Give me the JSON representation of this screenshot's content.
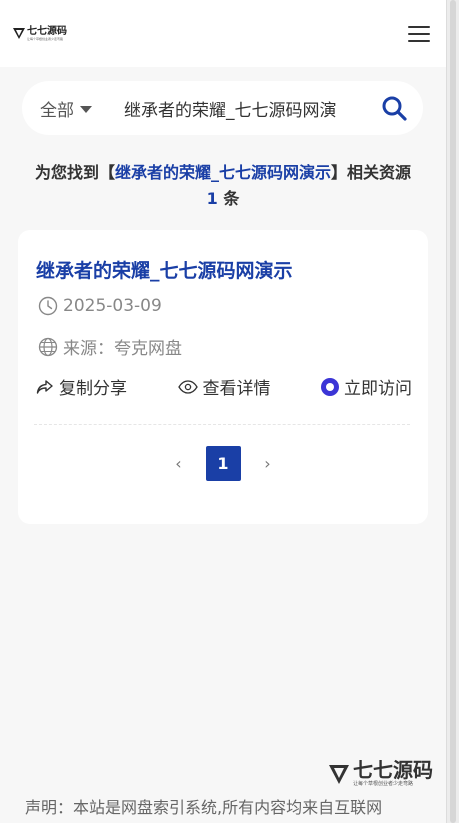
{
  "header": {
    "logo_text": "七七源码",
    "logo_subtext": "让每个草根创业者少走弯路",
    "menu_icon": "hamburger-menu-icon"
  },
  "search": {
    "category": "全部",
    "query": "继承者的荣耀_七七源码网演",
    "search_icon": "search-icon"
  },
  "summary": {
    "prefix": "为您找到【",
    "keyword": "继承者的荣耀_七七源码网演示",
    "middle": "】相关资源",
    "count": "1",
    "suffix": "条"
  },
  "result": {
    "title": "继承者的荣耀_七七源码网演示",
    "date": "2025-03-09",
    "source": "来源：夸克网盘",
    "actions": {
      "copy_share": "复制分享",
      "view_detail": "查看详情",
      "visit": "立即访问"
    }
  },
  "pagination": {
    "prev": "‹",
    "current": "1",
    "next": "›"
  },
  "footer": {
    "logo_text": "七七源码",
    "logo_slogan": "让每个草根创业者少走弯路",
    "disclaimer": "声明：本站是网盘索引系统,所有内容均来自互联网"
  },
  "colors": {
    "accent": "#1a3fa6",
    "visit": "#3b35d6"
  }
}
